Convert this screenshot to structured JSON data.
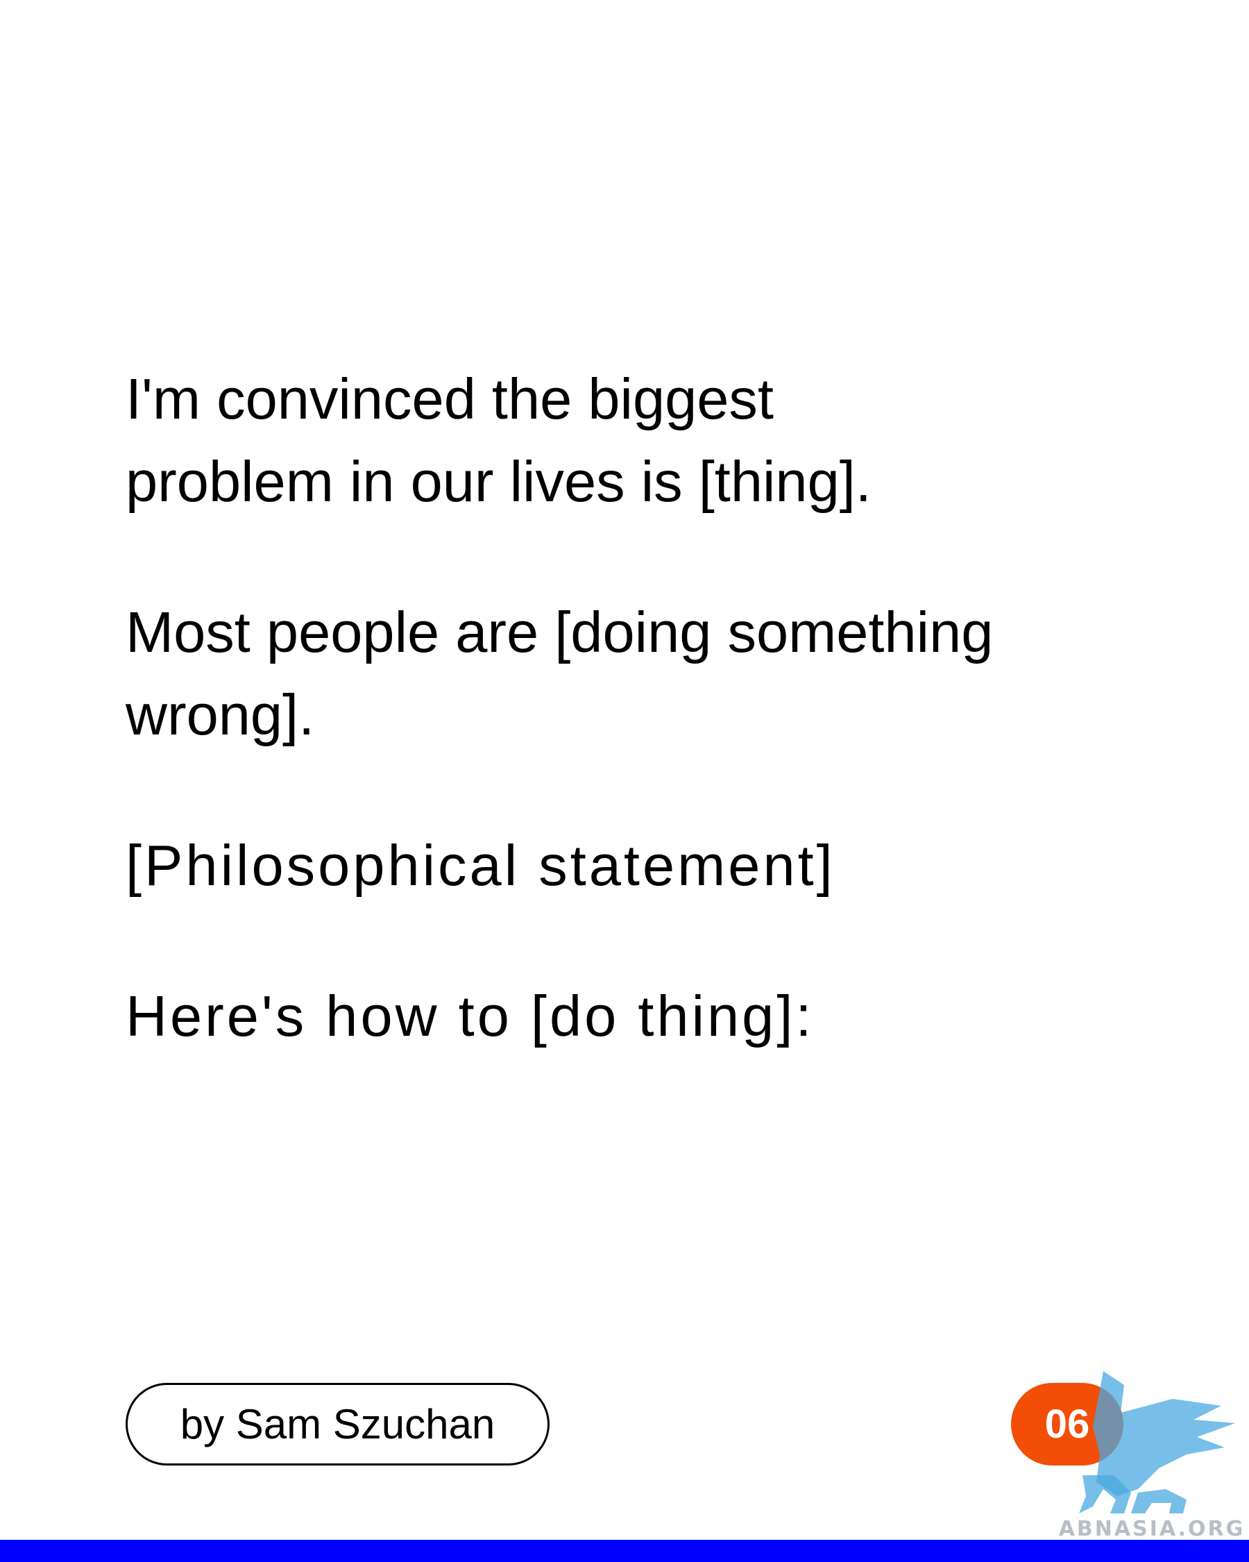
{
  "paragraphs": [
    {
      "lines": [
        "I'm convinced the biggest",
        "problem in our lives is [thing]."
      ]
    },
    {
      "lines": [
        "Most people are [doing something",
        "wrong]."
      ]
    },
    {
      "lines": [
        "[Philosophical statement]"
      ]
    },
    {
      "lines": [
        "Here's how to [do thing]:"
      ]
    }
  ],
  "footer": {
    "author_label": "by Sam Szuchan",
    "page_number": "06"
  },
  "watermark": {
    "text": "ABNASIA.ORG",
    "icon": "winged-lion-icon"
  },
  "colors": {
    "background": "#ffffff",
    "text": "#000000",
    "badge": "#f24e07",
    "bottom_bar": "#0000ff",
    "watermark": "#4aa8e0"
  }
}
